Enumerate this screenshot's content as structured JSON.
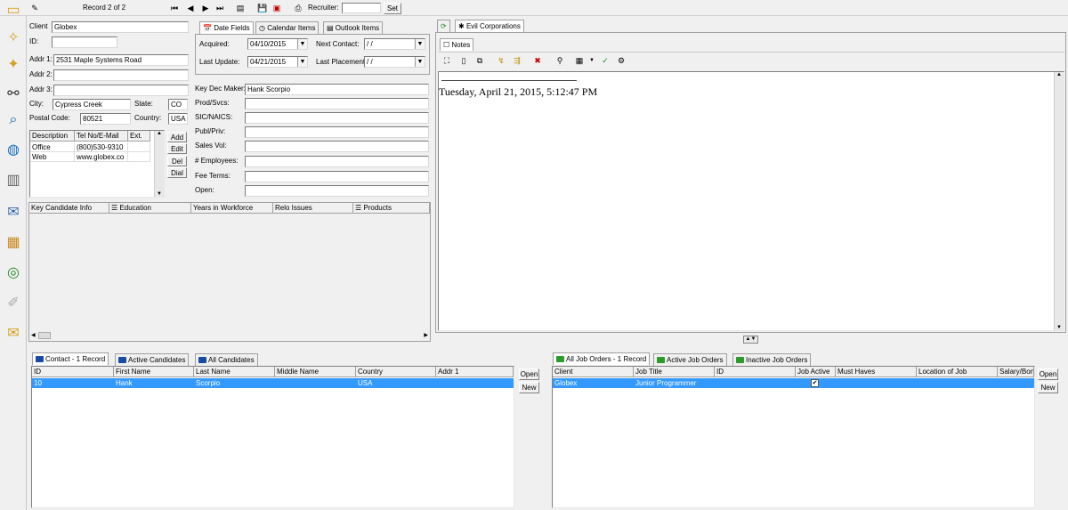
{
  "toolbar": {
    "record_label": "Record 2 of 2",
    "recruiter_label": "Recruiter:",
    "recruiter_value": "",
    "set_button": "Set"
  },
  "client_form": {
    "client_label": "Client",
    "client_value": "Globex",
    "id_label": "ID:",
    "id_value": "",
    "addr1_label": "Addr 1:",
    "addr1_value": "2531 Maple Systems Road",
    "addr2_label": "Addr 2:",
    "addr2_value": "",
    "addr3_label": "Addr 3:",
    "addr3_value": "",
    "city_label": "City:",
    "city_value": "Cypress Creek",
    "state_label": "State:",
    "state_value": "CO",
    "postal_label": "Postal Code:",
    "postal_value": "80521",
    "country_label": "Country:",
    "country_value": "USA"
  },
  "phone_table": {
    "headers": [
      "Description",
      "Tel No/E-Mail",
      "Ext."
    ],
    "rows": [
      [
        "Office",
        "(800)530-9310",
        ""
      ],
      [
        "Web",
        "www.globex.co",
        ""
      ]
    ],
    "buttons": [
      "Add",
      "Edit",
      "Del",
      "Dial"
    ]
  },
  "date_tabs": [
    "Date Fields",
    "Calendar Items",
    "Outlook Items"
  ],
  "date_fields": {
    "acquired_label": "Acquired:",
    "acquired_value": "04/10/2015",
    "next_contact_label": "Next Contact:",
    "next_contact_value": "/ /",
    "last_update_label": "Last Update:",
    "last_update_value": "04/21/2015",
    "last_placement_label": "Last Placement:",
    "last_placement_value": "/ /"
  },
  "company_fields": {
    "key_dec_label": "Key Dec Maker:",
    "key_dec_value": "Hank Scorpio",
    "prod_label": "Prod/Svcs:",
    "prod_value": "",
    "sic_label": "SIC/NAICS:",
    "sic_value": "",
    "publ_label": "Publ/Priv:",
    "publ_value": "",
    "sales_label": "Sales Vol:",
    "sales_value": "",
    "employees_label": "# Employees:",
    "employees_value": "",
    "fee_label": "Fee Terms:",
    "fee_value": "",
    "open_label": "Open:",
    "open_value": ""
  },
  "info_columns": [
    "Key Candidate Info",
    "Education",
    "Years in Workforce",
    "Relo Issues",
    "Products"
  ],
  "right_pane": {
    "tab_label": "Evil Corporations",
    "notes_tab": "Notes",
    "notes_text": "Tuesday, April 21, 2015, 5:12:47 PM"
  },
  "contacts": {
    "tabs": [
      "Contact - 1 Record",
      "Active Candidates",
      "All Candidates"
    ],
    "headers": [
      "ID",
      "First Name",
      "Last Name",
      "Middle Name",
      "Country",
      "Addr 1"
    ],
    "rows": [
      [
        "10",
        "Hank",
        "Scorpio",
        "",
        "USA",
        ""
      ]
    ],
    "open_button": "Open",
    "new_button": "New"
  },
  "job_orders": {
    "tabs": [
      "All Job Orders - 1 Record",
      "Active Job Orders",
      "Inactive Job Orders"
    ],
    "headers": [
      "Client",
      "Job Title",
      "ID",
      "Job Active",
      "Must Haves",
      "Location of Job",
      "Salary/Bon"
    ],
    "rows": [
      [
        "Globex",
        "Junior Programmer",
        "",
        "✔",
        "",
        "",
        ""
      ]
    ],
    "open_button": "Open",
    "new_button": "New"
  }
}
